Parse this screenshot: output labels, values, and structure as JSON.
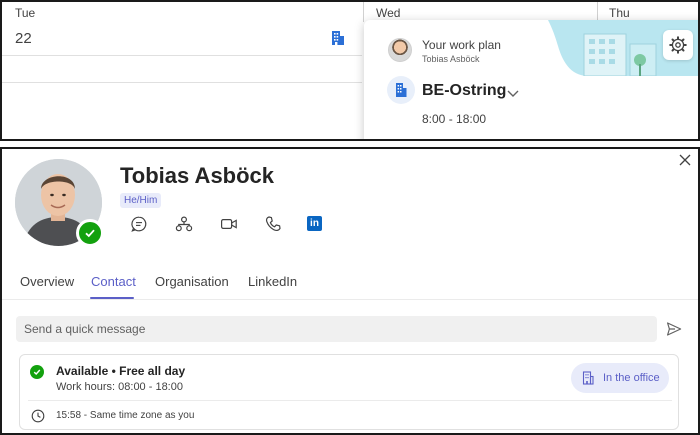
{
  "calendar": {
    "days": [
      "Tue",
      "Wed",
      "Thu"
    ],
    "date": "22"
  },
  "work_plan": {
    "title": "Your work plan",
    "person": "Tobias Asböck",
    "location": "BE-Ostring",
    "time": "8:00 - 18:00",
    "icons": {
      "building": "building-icon",
      "settings": "gear-icon",
      "expand": "chevron-down-icon"
    }
  },
  "profile": {
    "name": "Tobias Asböck",
    "pronouns": "He/Him",
    "presence": "available",
    "actions": [
      "chat-icon",
      "org-chart-icon",
      "video-call-icon",
      "phone-icon",
      "linkedin-icon"
    ],
    "linkedin_glyph": "in"
  },
  "tabs": [
    {
      "label": "Overview",
      "active": false
    },
    {
      "label": "Contact",
      "active": true
    },
    {
      "label": "Organisation",
      "active": false
    },
    {
      "label": "LinkedIn",
      "active": false
    }
  ],
  "quick_message": {
    "placeholder": "Send a quick message"
  },
  "status": {
    "availability": "Available • Free all day",
    "work_hours": "Work hours: 08:00 - 18:00",
    "location_button": "In the office",
    "timezone": "15:58 - Same time zone as you"
  },
  "colors": {
    "accent": "#5b5fc7",
    "available": "#13a10e",
    "linkedin": "#0a66c2",
    "building_blue": "#2b6fd6"
  }
}
